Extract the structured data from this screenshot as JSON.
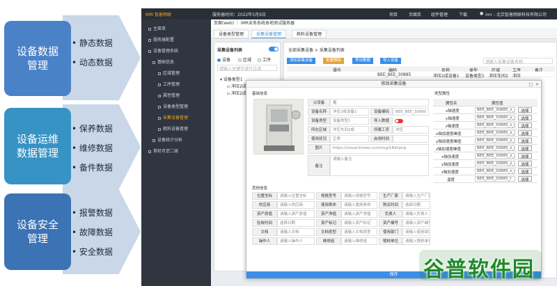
{
  "concepts": [
    {
      "title": "设备数据\n管理",
      "items": [
        "静态数据",
        "动态数据"
      ]
    },
    {
      "title": "设备运维\n数据管理",
      "items": [
        "保养数据",
        "维修数据",
        "备件数据"
      ]
    },
    {
      "title": "设备安全\n管理",
      "items": [
        "报警数据",
        "故障数据",
        "安全数据"
      ]
    }
  ],
  "topbar": {
    "logo": "IMR 智善物联",
    "server_time": "服务器时间：2022年5月9日",
    "nav": [
      "项目",
      "页面库",
      "组件管理",
      "下载"
    ],
    "user": "imr - 北京智善物联科技有限公司"
  },
  "sidebar": {
    "items": [
      "主菜单",
      "服务器配置",
      "设备管理系统",
      "基础信息",
      "区域管理",
      "工序管理",
      "属性管理",
      "设备类型管理",
      "采集设备管理",
      "耗料设备管理",
      "设备统计分析",
      "单机可逆二级"
    ],
    "active_index": 8
  },
  "breadcrumb": "页面(web) ｜ IMR业务系统本地测试服务器",
  "tabs": [
    "设备类型管理",
    "采集设备管理",
    "耗料设备管理"
  ],
  "tree": {
    "title": "采集设备列表",
    "radios": [
      "设备",
      "区域",
      "工序"
    ],
    "search_placeholder": "请输入关键字进行过滤",
    "nodes": [
      "设备类型1",
      "冲压2成设备1",
      "冲压2成设备2"
    ]
  },
  "main": {
    "title": "全部采集设备 > 采集设备列表",
    "buttons": [
      "添加采集设备",
      "批量删除",
      "导出数据",
      "导入设备"
    ],
    "search_placeholder": "请输入采集设备名称",
    "columns": [
      "操作",
      "编码",
      "名称",
      "类型",
      "区域",
      "工序",
      "备注"
    ],
    "row": [
      "",
      "BEE_BEE_30885",
      "冲压2成设备1",
      "设备类型1",
      "冲压车间2",
      "冲压",
      ""
    ]
  },
  "modal": {
    "title": "修改采集设备",
    "basic_header": "基础信息",
    "other_header": "其他信息",
    "type_header": "类型属性",
    "fields": [
      {
        "label": "父设备",
        "value": "无"
      },
      {
        "label": "设备名称",
        "value": "冲压2成设备1"
      },
      {
        "label": "设备编码",
        "value": "BEE_BEE_30885"
      },
      {
        "label": "设备类型",
        "value": "设备类型1"
      },
      {
        "label": "导入数据",
        "value": ""
      },
      {
        "label": "所在区域",
        "value": "冲压车间2成"
      },
      {
        "label": "所属工序",
        "value": "冲压"
      },
      {
        "label": "使用状况",
        "value": "正常"
      },
      {
        "label": "启用时间",
        "value": ""
      },
      {
        "label": "图片",
        "value": "https://cloud.krmes.com/img/18df.png"
      },
      {
        "label": "备注",
        "value": "请输入备注"
      }
    ],
    "other": [
      [
        "位置坐标",
        "请输入位置坐标",
        "规格型号",
        "请输入规格型号",
        "生产厂家",
        "请输入生产厂家"
      ],
      [
        "供应商",
        "请输入供应商",
        "使用寿命",
        "请输入使用寿命",
        "购买时间",
        "选择日期"
      ],
      [
        "资产原值",
        "请输入资产原值",
        "资产净值",
        "请输入资产净值",
        "负责人",
        "请输入负责人"
      ],
      [
        "验收时间",
        "选择日期",
        "资产标记",
        "请输入资产标记",
        "资产编号",
        "请输入资产编号"
      ],
      [
        "文档",
        "请输入文档",
        "文档类型",
        "请输入文档类型",
        "使用部门",
        "请输入使用部门"
      ],
      [
        "操作人",
        "请输入操作人",
        "维修组",
        "请输入维修组",
        "稽核单位",
        "请输入稽核单位"
      ]
    ],
    "prop_cols": [
      "属性名",
      "属性值"
    ],
    "props": [
      [
        "x轴速度",
        "BEE_BEE_30885_x_spee"
      ],
      [
        "y轴速度",
        "BEE_BEE_30885_y_spee"
      ],
      [
        "z轴速度",
        "BEE_BEE_30885_z_spee"
      ],
      [
        "x轴加速度峰值",
        "BEE_BEE_30885_x_aeff"
      ],
      [
        "y轴加速度峰值",
        "BEE_BEE_30885_y_aeff"
      ],
      [
        "z轴加速度峰值",
        "BEE_BEE_30885_z_aeff"
      ],
      [
        "x轴加速度",
        "BEE_BEE_30885_x_ama"
      ],
      [
        "y轴加速度",
        "BEE_BEE_30885_y_ama"
      ],
      [
        "z轴加速度",
        "BEE_BEE_30885_z_ama"
      ],
      [
        "温度",
        "BEE_BEE_30885_t"
      ]
    ],
    "select_label": "选择",
    "save_label": "保存"
  },
  "watermark": "谷普软件园"
}
